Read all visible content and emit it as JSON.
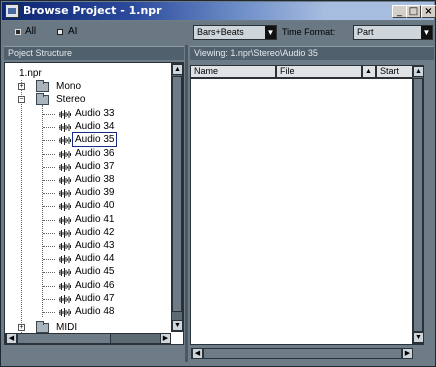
{
  "window": {
    "title": "Browse Project - 1.npr",
    "min_label": "_",
    "max_label": "□",
    "close_label": "×"
  },
  "toolbar": {
    "filter_options": [
      {
        "label": "All",
        "selected": true
      },
      {
        "label": "AI",
        "selected": false
      }
    ],
    "mode_dropdown": "Bars+Beats",
    "time_format_label": "Time Format:",
    "time_format_value": "Part"
  },
  "left_panel": {
    "header": "Poject Structure"
  },
  "right_panel": {
    "path": "Viewing: 1.npr\\Stereo\\Audio 35",
    "columns": [
      "Name",
      "File",
      "▲",
      "Start"
    ]
  },
  "tree": {
    "root": "1.npr",
    "folders": [
      "Mono",
      "Stereo",
      "MIDI"
    ],
    "audio_items": [
      "Audio 33",
      "Audio 34",
      "Audio 35",
      "Audio 36",
      "Audio 37",
      "Audio 38",
      "Audio 39",
      "Audio 40",
      "Audio 41",
      "Audio 42",
      "Audio 43",
      "Audio 44",
      "Audio 45",
      "Audio 46",
      "Audio 47",
      "Audio 48"
    ],
    "selected_item": "Audio 35"
  },
  "colors": {
    "selected_outline": "#1a2a8a",
    "panel_bg": "#6e7c87",
    "title_start": "#0a2470"
  }
}
